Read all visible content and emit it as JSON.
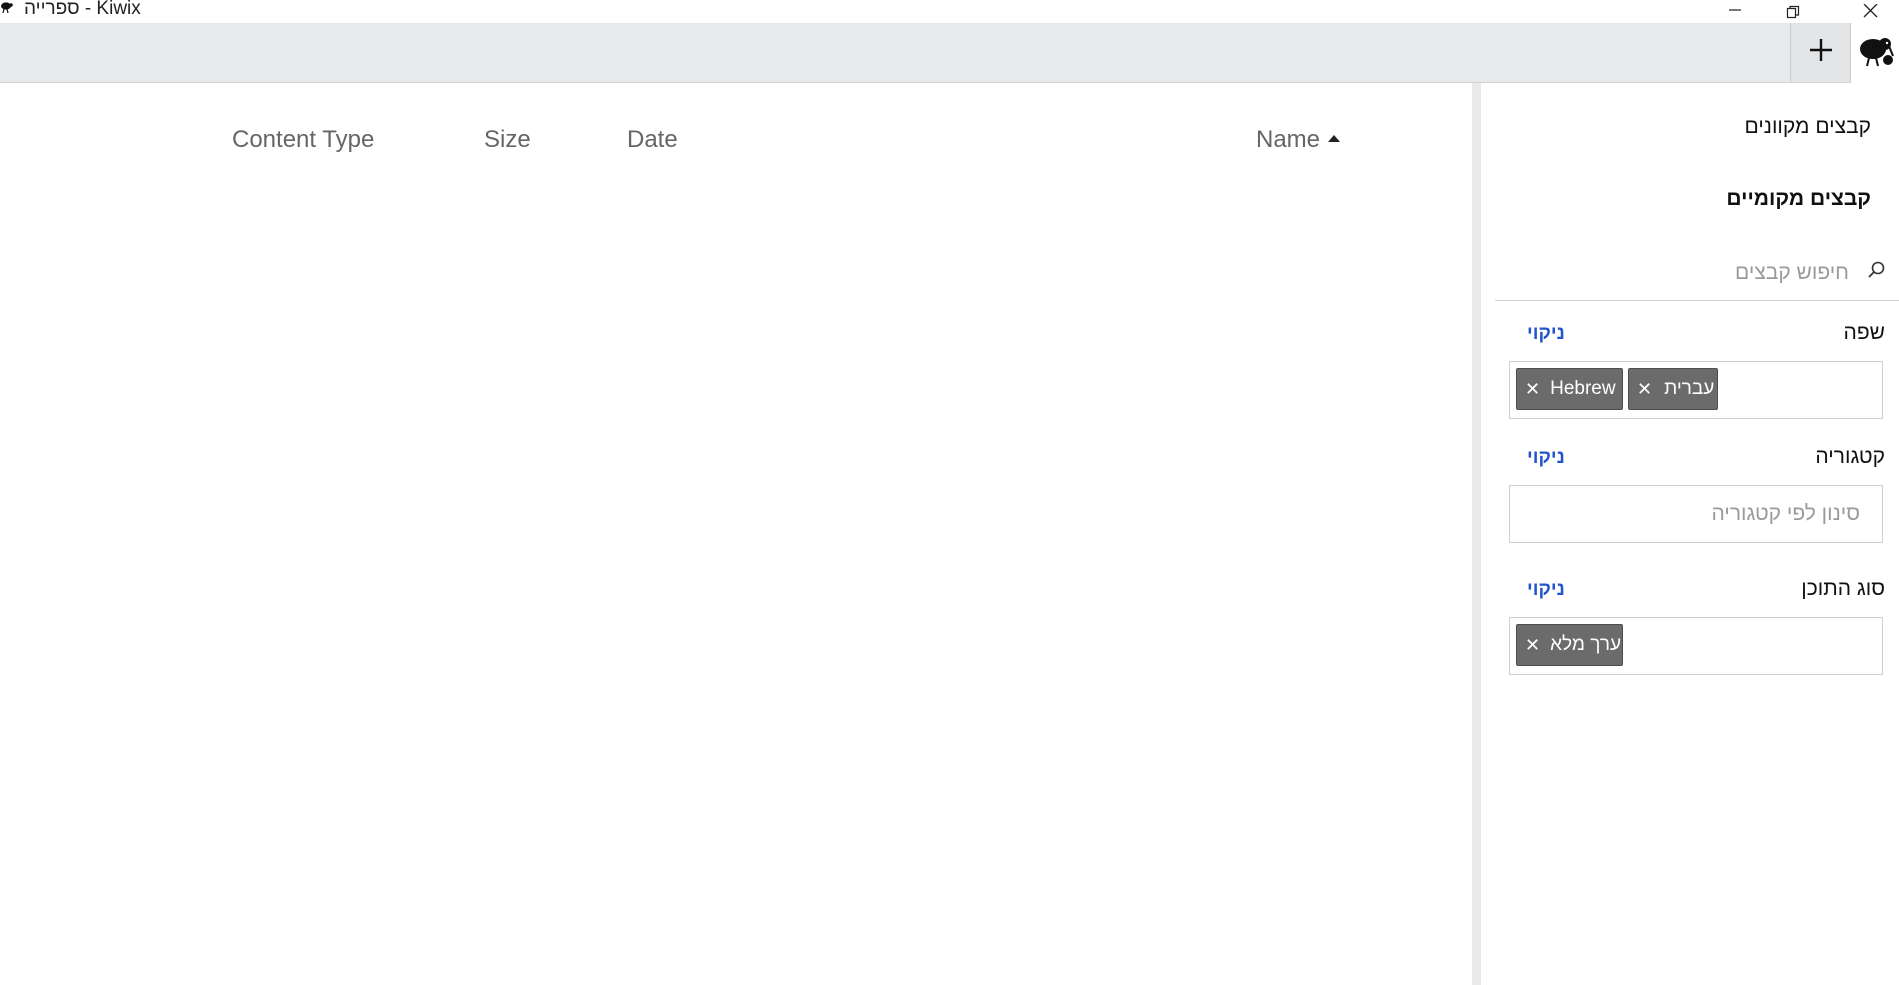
{
  "window": {
    "title": "ספרייה - Kiwix",
    "minimize_icon": "minimize-icon",
    "maximize_icon": "restore-icon",
    "close_icon": "close-icon"
  },
  "tabbar": {
    "new_tab_icon": "plus-icon",
    "home_icon": "kiwix-logo-icon"
  },
  "content_list": {
    "columns": [
      {
        "label": "Content Type"
      },
      {
        "label": "Size"
      },
      {
        "label": "Date"
      },
      {
        "label": "Name",
        "sorted": "ascending"
      }
    ]
  },
  "side_panel": {
    "online_files": "קבצים מקוונים",
    "local_files": "קבצים מקומיים",
    "search": {
      "placeholder": "חיפוש קבצים",
      "value": "",
      "icon": "search-icon"
    },
    "filters": [
      {
        "label": "שפה",
        "clear": "ניקוי",
        "chips": [
          "Hebrew",
          "עברית"
        ],
        "placeholder": ""
      },
      {
        "label": "קטגוריה",
        "clear": "ניקוי",
        "chips": [],
        "placeholder": "סינון לפי קטגוריה"
      },
      {
        "label": "סוג התוכן",
        "clear": "ניקוי",
        "chips": [
          "ערך מלא"
        ],
        "placeholder": ""
      }
    ]
  },
  "colors": {
    "tabbar_bg": "#e8e9eb",
    "clear_link": "#2255cc",
    "chip_bg": "#6b6b6b"
  }
}
